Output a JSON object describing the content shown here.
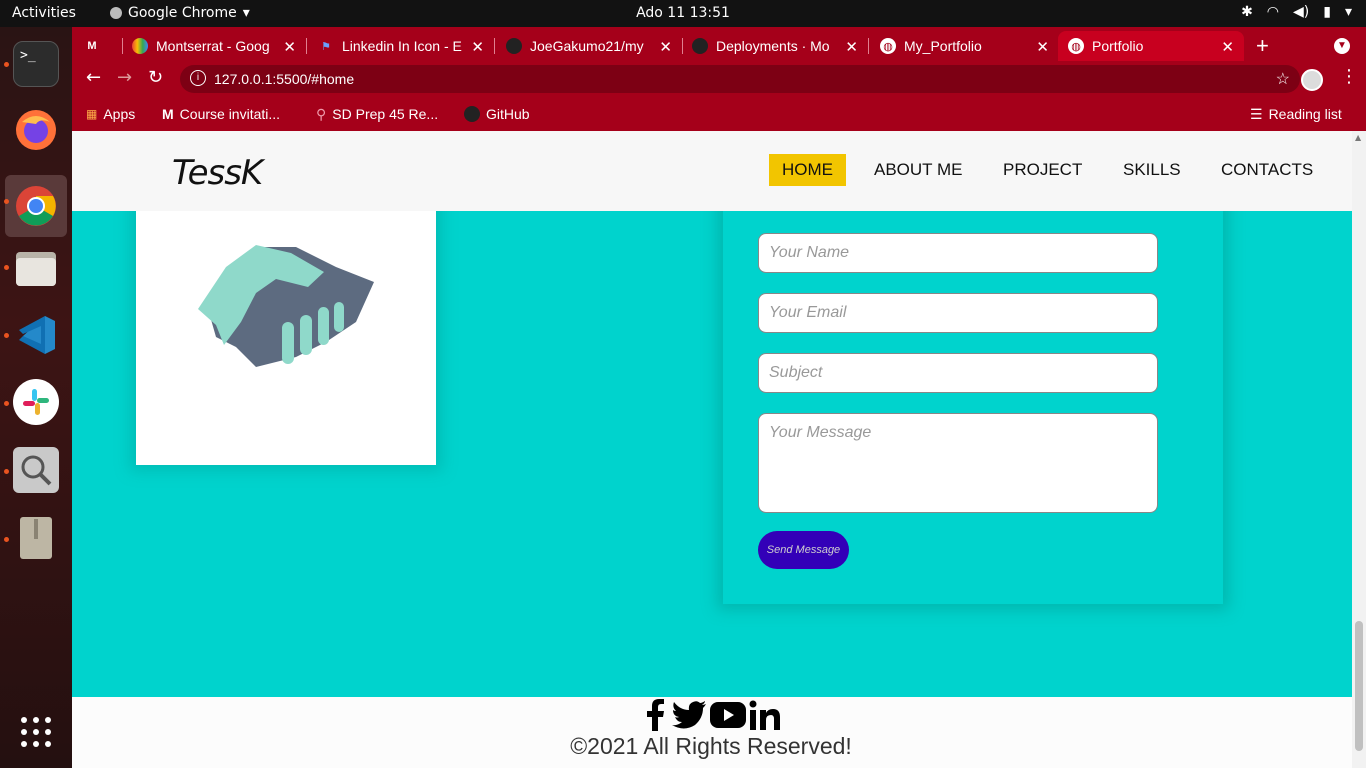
{
  "system": {
    "activities": "Activities",
    "app_name": "Google Chrome",
    "clock": "Ado 11  13:51"
  },
  "tabs": [
    {
      "label": "",
      "icon": "gmail-icon"
    },
    {
      "label": "Montserrat - Goog",
      "icon": "google-fonts-icon"
    },
    {
      "label": "Linkedin In Icon - E",
      "icon": "flag-icon"
    },
    {
      "label": "JoeGakumo21/my",
      "icon": "github-icon"
    },
    {
      "label": "Deployments · Mo",
      "icon": "github-icon"
    },
    {
      "label": "My_Portfolio",
      "icon": "globe-icon"
    },
    {
      "label": "Portfolio",
      "icon": "globe-icon"
    }
  ],
  "address": {
    "url": "127.0.0.1:5500/#home"
  },
  "bookmarks": {
    "apps": "Apps",
    "b1": "Course invitati...",
    "b2": "SD Prep 45 Re...",
    "b3": "GitHub",
    "reading": "Reading list"
  },
  "site": {
    "logo": "TessK",
    "nav": [
      "HOME",
      "ABOUT ME",
      "PROJECT",
      "SKILLS",
      "CONTACTS"
    ],
    "form": {
      "name": "Your Name",
      "email": "Your Email",
      "subject": "Subject",
      "message": "Your Message",
      "send": "Send Message"
    },
    "footer": {
      "copyright": "©2021 All Rights Reserved!"
    }
  },
  "colors": {
    "chrome": "#a5001a",
    "page_bg": "#00d3cd",
    "nav_active": "#f2c500",
    "send_button": "#3300b8"
  }
}
